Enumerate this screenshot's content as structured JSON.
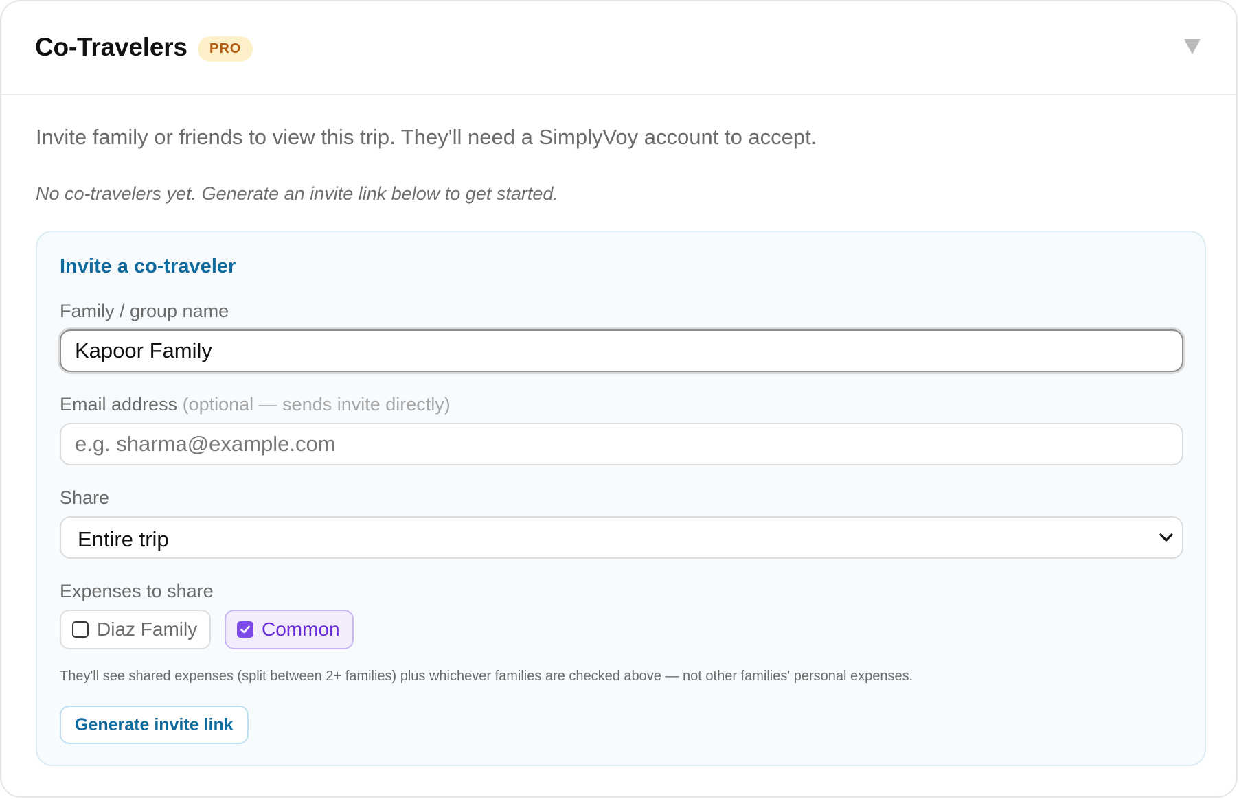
{
  "header": {
    "title": "Co-Travelers",
    "badge": "PRO"
  },
  "intro": "Invite family or friends to view this trip. They'll need a SimplyVoy account to accept.",
  "empty_note": "No co-travelers yet. Generate an invite link below to get started.",
  "invite": {
    "title": "Invite a co-traveler",
    "group_name": {
      "label": "Family / group name",
      "value": "Kapoor Family"
    },
    "email": {
      "label": "Email address",
      "hint": "(optional — sends invite directly)",
      "placeholder": "e.g. sharma@example.com",
      "value": ""
    },
    "share": {
      "label": "Share",
      "selected": "Entire trip"
    },
    "expenses": {
      "label": "Expenses to share",
      "options": [
        {
          "label": "Diaz Family",
          "checked": false
        },
        {
          "label": "Common",
          "checked": true
        }
      ]
    },
    "helper": "They'll see shared expenses (split between 2+ families) plus whichever families are checked above — not other families' personal expenses.",
    "generate_label": "Generate invite link"
  },
  "colors": {
    "accent": "#0f6a9e",
    "checked": "#7c4ae6",
    "badge_bg": "#fdf0c8",
    "badge_text": "#b45a10"
  }
}
